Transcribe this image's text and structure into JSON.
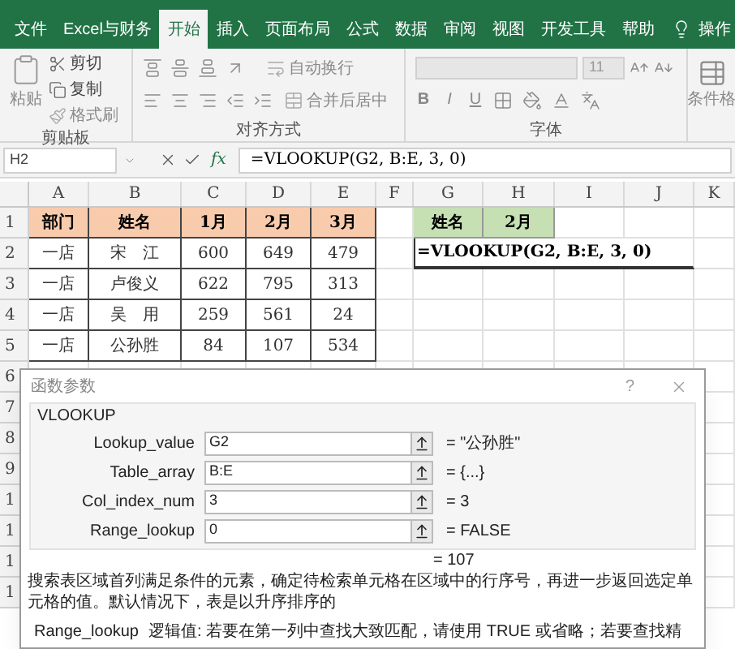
{
  "ribbon_tabs": [
    {
      "label": "文件",
      "selected": false
    },
    {
      "label": "Excel与财务",
      "selected": false
    },
    {
      "label": "开始",
      "selected": true
    },
    {
      "label": "插入",
      "selected": false
    },
    {
      "label": "页面布局",
      "selected": false
    },
    {
      "label": "公式",
      "selected": false
    },
    {
      "label": "数据",
      "selected": false
    },
    {
      "label": "审阅",
      "selected": false
    },
    {
      "label": "视图",
      "selected": false
    },
    {
      "label": "开发工具",
      "selected": false
    },
    {
      "label": "帮助",
      "selected": false
    }
  ],
  "tell_me": "操作",
  "clipboard": {
    "paste": "粘贴",
    "cut": "剪切",
    "copy": "复制",
    "format_painter": "格式刷",
    "label": "剪贴板"
  },
  "alignment": {
    "wrap_text": "自动换行",
    "merge_center": "合并后居中",
    "label": "对齐方式"
  },
  "font": {
    "size": "11",
    "bold": "B",
    "italic": "I",
    "underline": "U",
    "label": "字体"
  },
  "styles": {
    "conditional_format": "条件格"
  },
  "formula_bar": {
    "name_box": "H2",
    "function_button": "fx",
    "formula": "=VLOOKUP(G2, B:E, 3, 0)"
  },
  "sheet": {
    "columns": [
      "A",
      "B",
      "C",
      "D",
      "E",
      "F",
      "G",
      "H",
      "I",
      "J",
      "K"
    ],
    "row_numbers": [
      "1",
      "2",
      "3",
      "4",
      "5",
      "6",
      "7",
      "8",
      "9",
      "1",
      "1",
      "1",
      "1"
    ],
    "table": {
      "color": "#f8cbad",
      "header": [
        "部门",
        "姓名",
        "1月",
        "2月",
        "3月"
      ],
      "rows": [
        [
          "一店",
          "宋　江",
          "600",
          "649",
          "479"
        ],
        [
          "一店",
          "卢俊义",
          "622",
          "795",
          "313"
        ],
        [
          "一店",
          "吴　用",
          "259",
          "561",
          "24"
        ],
        [
          "一店",
          "公孙胜",
          "84",
          "107",
          "534"
        ]
      ]
    },
    "lookup": {
      "color": "#c6e0b4",
      "header": [
        "姓名",
        "2月"
      ],
      "formula": "=VLOOKUP(G2, B:E, 3, 0)"
    }
  },
  "dialog": {
    "title": "函数参数",
    "help": "?",
    "function_name": "VLOOKUP",
    "arguments": [
      {
        "label": "Lookup_value",
        "value": "G2",
        "result": "= \"公孙胜\""
      },
      {
        "label": "Table_array",
        "value": "B:E",
        "result": "= {...}"
      },
      {
        "label": "Col_index_num",
        "value": "3",
        "result": "= 3"
      },
      {
        "label": "Range_lookup",
        "value": "0",
        "result": "= FALSE"
      }
    ],
    "result": "= 107",
    "description": "搜索表区域首列满足条件的元素，确定待检索单元格在区域中的行序号，再进一步返回选定单元格的值。默认情况下，表是以升序排序的",
    "parameter_name": "Range_lookup",
    "parameter_description": "逻辑值: 若要在第一列中查找大致匹配，请使用 TRUE 或省略；若要查找精"
  }
}
